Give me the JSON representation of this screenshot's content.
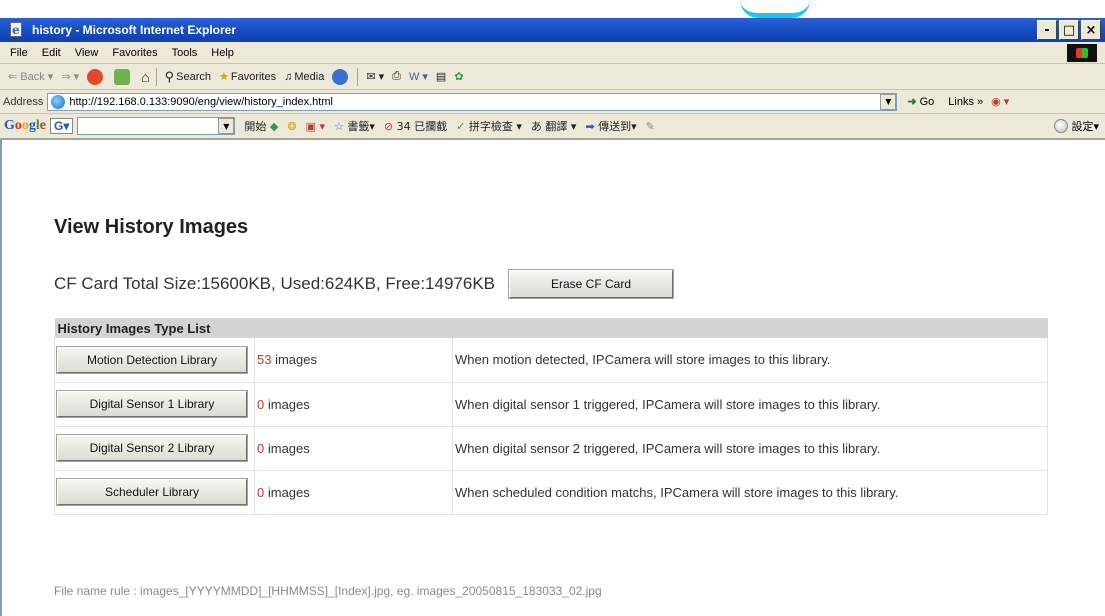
{
  "window": {
    "title": "history - Microsoft Internet Explorer",
    "buttons": [
      "-",
      "□",
      "×"
    ]
  },
  "menu": [
    "File",
    "Edit",
    "View",
    "Favorites",
    "Tools",
    "Help"
  ],
  "toolbar": {
    "back": "Back",
    "search": "Search",
    "favorites": "Favorites",
    "media": "Media"
  },
  "address": {
    "label": "Address",
    "url": "http://192.168.0.133:9090/eng/view/history_index.html",
    "go": "Go",
    "links": "Links"
  },
  "google": {
    "logo": [
      "G",
      "o",
      "o",
      "g",
      "l",
      "e"
    ],
    "search_button": "G",
    "start": "開始",
    "bookmarks": "書籤",
    "blocked": "34 已攔截",
    "spell": "拼字檢查",
    "translate": "翻譯",
    "send": "傳送到",
    "settings": "設定"
  },
  "page": {
    "title": "View History Images",
    "cf_card": "CF Card Total Size:15600KB, Used:624KB, Free:14976KB",
    "erase_button": "Erase CF Card",
    "table_header": "History Images Type List",
    "libraries": [
      {
        "button": "Motion Detection Library",
        "count": "53",
        "unit": " images",
        "description": "When motion detected, IPCamera will store images to this library."
      },
      {
        "button": "Digital Sensor 1 Library",
        "count": "0",
        "unit": " images",
        "description": "When digital sensor 1 triggered, IPCamera will store images to this library."
      },
      {
        "button": "Digital Sensor 2 Library",
        "count": "0",
        "unit": " images",
        "description": "When digital sensor 2 triggered, IPCamera will store images to this library."
      },
      {
        "button": "Scheduler Library",
        "count": "0",
        "unit": " images",
        "description": "When scheduled condition matchs, IPCamera will store images to this library."
      }
    ],
    "file_rule": "File name rule : images_[YYYYMMDD]_[HHMMSS]_[Index].jpg, eg. images_20050815_183033_02.jpg"
  },
  "colors": {
    "titlebar": "#1a4fc4",
    "chrome": "#ece9d8",
    "count_red": "#c0392b"
  }
}
